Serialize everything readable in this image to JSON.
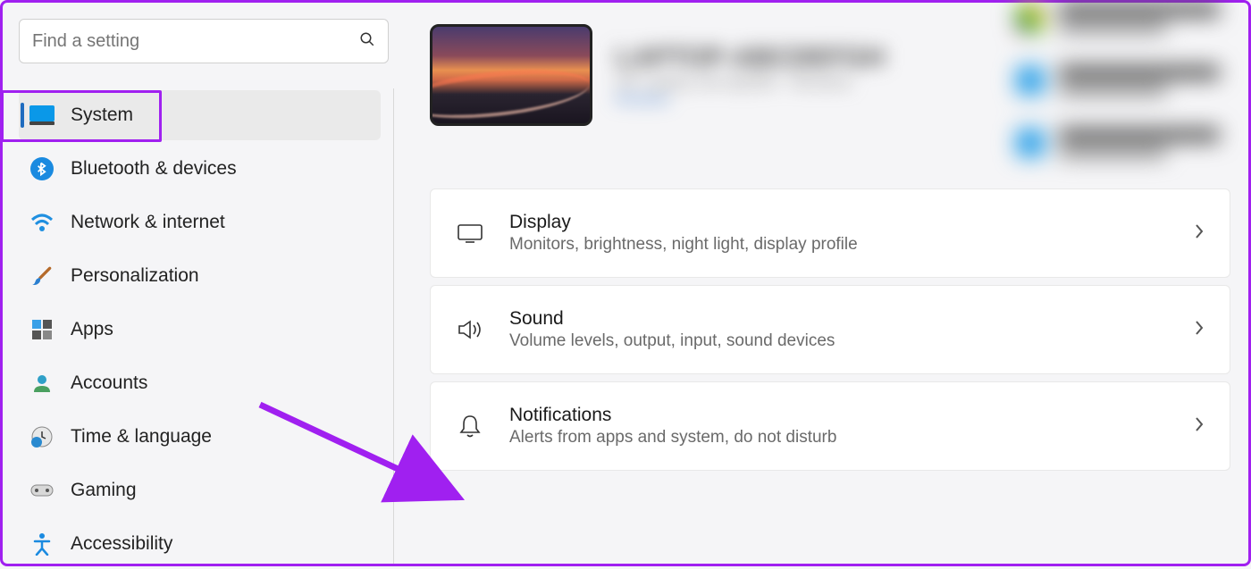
{
  "search": {
    "placeholder": "Find a setting"
  },
  "sidebar": {
    "items": [
      {
        "label": "System"
      },
      {
        "label": "Bluetooth & devices"
      },
      {
        "label": "Network & internet"
      },
      {
        "label": "Personalization"
      },
      {
        "label": "Apps"
      },
      {
        "label": "Accounts"
      },
      {
        "label": "Time & language"
      },
      {
        "label": "Gaming"
      },
      {
        "label": "Accessibility"
      }
    ]
  },
  "main": {
    "cards": [
      {
        "title": "Display",
        "desc": "Monitors, brightness, night light, display profile"
      },
      {
        "title": "Sound",
        "desc": "Volume levels, output, input, sound devices"
      },
      {
        "title": "Notifications",
        "desc": "Alerts from apps and system, do not disturb"
      }
    ]
  },
  "colors": {
    "highlight": "#a020f0",
    "accent": "#1f6cbf"
  }
}
